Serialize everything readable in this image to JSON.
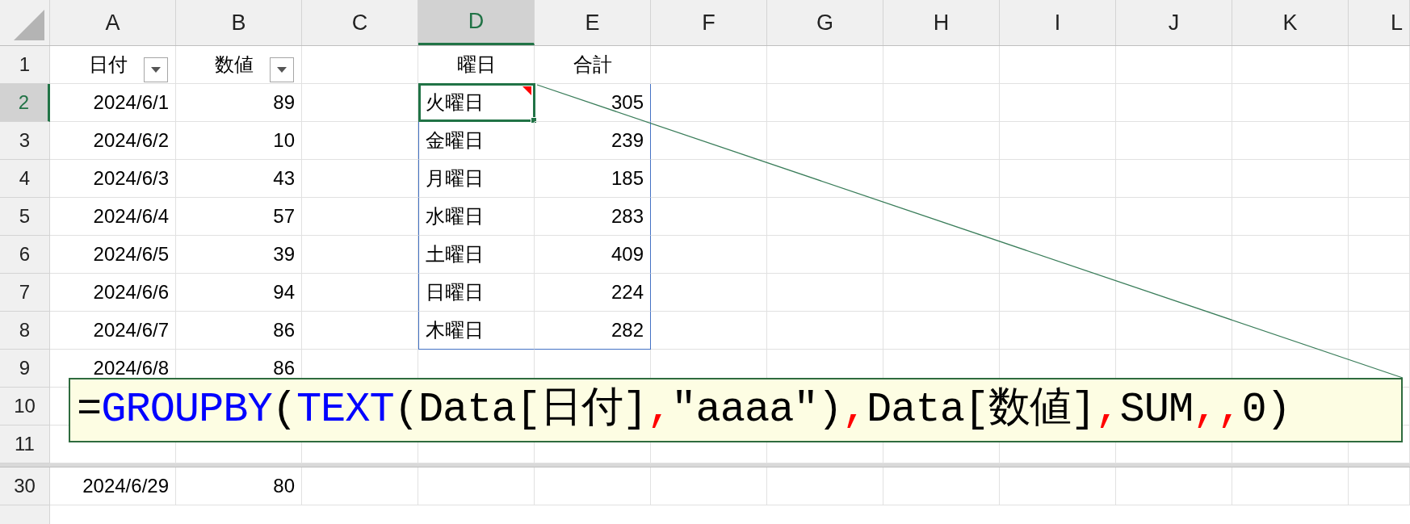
{
  "columns": [
    {
      "label": "A",
      "selected": false
    },
    {
      "label": "B",
      "selected": false
    },
    {
      "label": "C",
      "selected": false
    },
    {
      "label": "D",
      "selected": true
    },
    {
      "label": "E",
      "selected": false
    },
    {
      "label": "F",
      "selected": false
    },
    {
      "label": "G",
      "selected": false
    },
    {
      "label": "H",
      "selected": false
    },
    {
      "label": "I",
      "selected": false
    },
    {
      "label": "J",
      "selected": false
    },
    {
      "label": "K",
      "selected": false
    },
    {
      "label": "L",
      "selected": false
    }
  ],
  "header_row": {
    "label": "1",
    "selected": false,
    "date": "日付",
    "value": "数値",
    "filter": true,
    "weekday": "曜日",
    "total": "合計"
  },
  "rows": [
    {
      "label": "2",
      "selected": true,
      "date": "2024/6/1",
      "value": "89",
      "weekday": "火曜日",
      "total": "305",
      "active": true,
      "note": true,
      "spill": true
    },
    {
      "label": "3",
      "selected": false,
      "date": "2024/6/2",
      "value": "10",
      "weekday": "金曜日",
      "total": "239",
      "spill": true
    },
    {
      "label": "4",
      "selected": false,
      "date": "2024/6/3",
      "value": "43",
      "weekday": "月曜日",
      "total": "185",
      "spill": true
    },
    {
      "label": "5",
      "selected": false,
      "date": "2024/6/4",
      "value": "57",
      "weekday": "水曜日",
      "total": "283",
      "spill": true
    },
    {
      "label": "6",
      "selected": false,
      "date": "2024/6/5",
      "value": "39",
      "weekday": "土曜日",
      "total": "409",
      "spill": true
    },
    {
      "label": "7",
      "selected": false,
      "date": "2024/6/6",
      "value": "94",
      "weekday": "日曜日",
      "total": "224",
      "spill": true
    },
    {
      "label": "8",
      "selected": false,
      "date": "2024/6/7",
      "value": "86",
      "weekday": "木曜日",
      "total": "282",
      "spill": true
    },
    {
      "label": "9",
      "selected": false,
      "date": "2024/6/8",
      "value": "86"
    },
    {
      "label": "10",
      "selected": false
    },
    {
      "label": "11",
      "selected": false
    }
  ],
  "rows_after_split": [
    {
      "label": "30",
      "selected": false,
      "date": "2024/6/29",
      "value": "80"
    }
  ],
  "callout": {
    "formula": [
      {
        "kind": "text",
        "text": "="
      },
      {
        "kind": "function",
        "text": "GROUPBY"
      },
      {
        "kind": "text",
        "text": "("
      },
      {
        "kind": "function",
        "text": "TEXT"
      },
      {
        "kind": "text",
        "text": "(Data[日付]"
      },
      {
        "kind": "separator",
        "text": ","
      },
      {
        "kind": "text",
        "text": "\"aaaa\")"
      },
      {
        "kind": "separator",
        "text": ","
      },
      {
        "kind": "text",
        "text": "Data[数値]"
      },
      {
        "kind": "separator",
        "text": ","
      },
      {
        "kind": "text",
        "text": "SUM"
      },
      {
        "kind": "separator",
        "text": ",,"
      },
      {
        "kind": "text",
        "text": "0)"
      }
    ]
  }
}
